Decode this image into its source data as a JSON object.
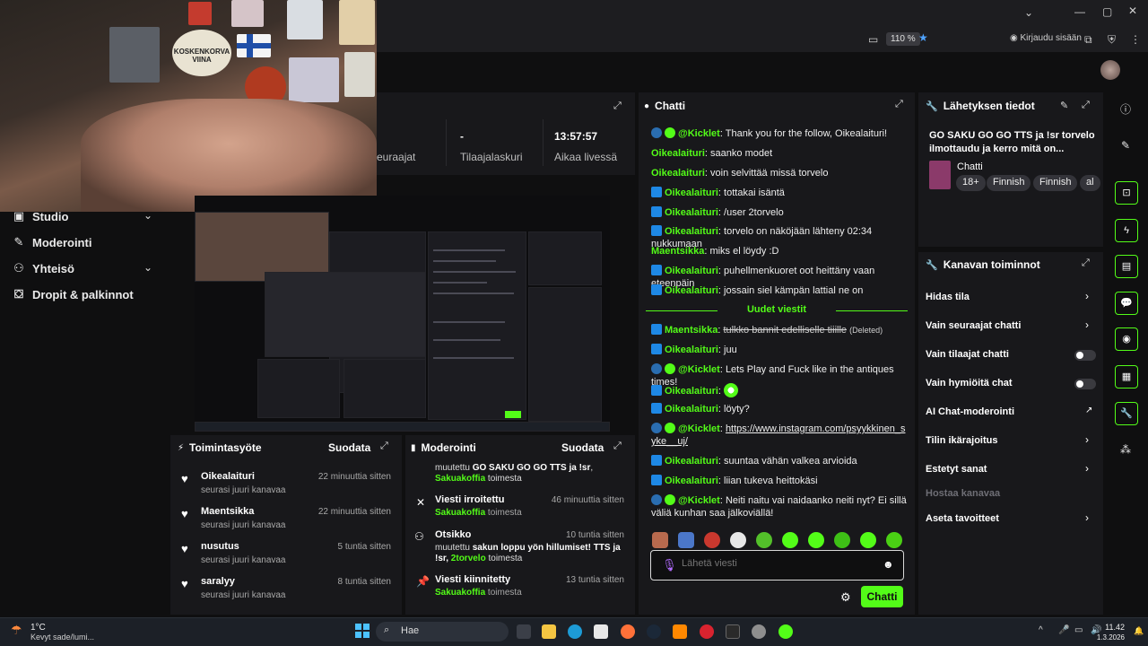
{
  "browser": {
    "zoom": "110 %",
    "login_label": "Kirjaudu sisään"
  },
  "nav": {
    "items": [
      {
        "label": "Studio"
      },
      {
        "label": "Moderointi"
      },
      {
        "label": "Yhteisö"
      },
      {
        "label": "Dropit & palkinnot"
      }
    ]
  },
  "webcam": {
    "poster_text": "KOSKENKORVA VIINA"
  },
  "stats": {
    "col1_label": "euraajat",
    "col2_value": "-",
    "col2_label": "Tilaajalaskuri",
    "col3_value": "13:57:57",
    "col3_label": "Aikaa livessä"
  },
  "activity": {
    "title": "Toimintasyöte",
    "filter": "Suodata",
    "rows": [
      {
        "name": "Oikealaituri",
        "sub": "seurasi juuri kanavaa",
        "time": "22 minuuttia sitten"
      },
      {
        "name": "Maentsikka",
        "sub": "seurasi juuri kanavaa",
        "time": "22 minuuttia sitten"
      },
      {
        "name": "nusutus",
        "sub": "seurasi juuri kanavaa",
        "time": "5 tuntia sitten"
      },
      {
        "name": "saralyy",
        "sub": "seurasi juuri kanavaa",
        "time": "8 tuntia sitten"
      }
    ]
  },
  "moderation": {
    "title": "Moderointi",
    "filter": "Suodata",
    "top_text": "muutettu",
    "top_bold": "GO SAKU GO GO TTS ja !sr",
    "top_user": "Sakuakoffia",
    "top_suffix": "toimesta",
    "rows": [
      {
        "title": "Viesti irroitettu",
        "time": "46 minuuttia sitten",
        "user": "Sakuakoffia",
        "suffix": "toimesta"
      },
      {
        "title": "Otsikko",
        "time": "10 tuntia sitten",
        "prefix": "muutettu",
        "bold": "sakun loppu yön hillumiset! TTS ja !sr,",
        "user": "2torvelo",
        "suffix": "toimesta"
      },
      {
        "title": "Viesti kiinnitetty",
        "time": "13 tuntia sitten",
        "user": "Sakuakoffia",
        "suffix": "toimesta"
      }
    ]
  },
  "chat": {
    "title": "Chatti",
    "new_messages": "Uudet viestit",
    "messages_before": [
      {
        "user": "@Kicklet",
        "text": "Thank you for the follow, Oikealaituri!",
        "badge": "bot"
      },
      {
        "user": "Oikealaituri",
        "text": "saanko modet",
        "badge": "none"
      },
      {
        "user": "Oikealaituri",
        "text": "voin selvittää missä torvelo",
        "badge": "none"
      },
      {
        "user": "Oikealaituri",
        "text": "tottakai isäntä",
        "badge": "blue"
      },
      {
        "user": "Oikealaituri",
        "text": "/user 2torvelo",
        "badge": "blue"
      },
      {
        "user": "Oikealaituri",
        "text": "torvelo on näköjään lähteny 02:34 nukkumaan",
        "badge": "blue"
      },
      {
        "user": "Maentsikka",
        "text": "miks el löydy :D",
        "badge": "none"
      },
      {
        "user": "Oikealaituri",
        "text": "puhellmenkuoret oot heittäny vaan eteenpäin",
        "badge": "blue"
      },
      {
        "user": "Oikealaituri",
        "text": "jossain siel kämpän lattial ne on",
        "badge": "blue"
      }
    ],
    "deleted_user": "Maentsikka",
    "deleted_text": "tulkko bannit edelliselle tiiille",
    "deleted_label": "(Deleted)",
    "messages_after": [
      {
        "user": "Oikealaituri",
        "text": "juu",
        "badge": "blue"
      },
      {
        "user": "@Kicklet",
        "text": "Lets Play and Fuck like in the antiques times!",
        "badge": "bot"
      },
      {
        "user": "Oikealaituri",
        "text": "",
        "badge": "blue"
      },
      {
        "user": "Oikealaituri",
        "text": "löyty?",
        "badge": "blue"
      }
    ],
    "link_user": "@Kicklet",
    "link_text": "https://www.instagram.com/psyykkinen_syke__uj/",
    "messages_end": [
      {
        "user": "Oikealaituri",
        "text": "suuntaa vähän valkea arvioida",
        "badge": "blue"
      },
      {
        "user": "Oikealaituri",
        "text": "liian tukeva heittokäsi",
        "badge": "blue"
      }
    ],
    "last_user": "@Kicklet",
    "last_text": "Neiti naitu vai naidaanko neiti nyt? Ei sillä väliä kunhan saa jälkoviällä!",
    "input_placeholder": "Lähetä viesti",
    "send_label": "Chatti"
  },
  "streaminfo": {
    "title": "Lähetyksen tiedot",
    "stream_title": "GO SAKU GO GO TTS ja !sr torvelo ilmottaudu ja kerro mitä on...",
    "category": "Chatti",
    "tags": [
      "18+",
      "Finnish",
      "Finnish",
      "al"
    ]
  },
  "channel_actions": {
    "title": "Kanavan toiminnot",
    "items": [
      {
        "label": "Hidas tila",
        "control": "chevron"
      },
      {
        "label": "Vain seuraajat chatti",
        "control": "chevron"
      },
      {
        "label": "Vain tilaajat chatti",
        "control": "toggle"
      },
      {
        "label": "Vain hymiöitä chat",
        "control": "toggle"
      },
      {
        "label": "AI Chat-moderointi",
        "control": "external"
      },
      {
        "label": "Tilin ikärajoitus",
        "control": "chevron"
      },
      {
        "label": "Estetyt sanat",
        "control": "chevron"
      },
      {
        "label": "Hostaa kanavaa",
        "control": "none"
      },
      {
        "label": "Aseta tavoitteet",
        "control": "chevron"
      }
    ]
  },
  "taskbar": {
    "weather_temp": "1°C",
    "weather_text": "Kevyt sade/lumi...",
    "search": "Hae",
    "time": "11.42",
    "date": "1.3.2026"
  },
  "colors": {
    "accent": "#53fc18",
    "panel": "#18181b",
    "background": "#0f0f10"
  }
}
